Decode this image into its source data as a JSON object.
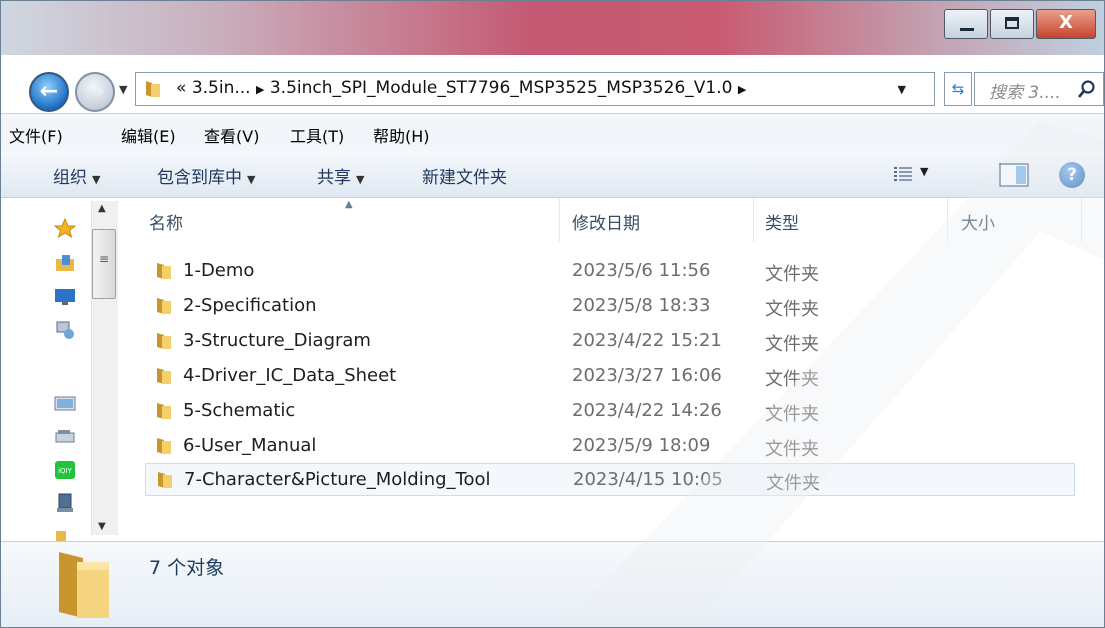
{
  "window": {
    "minimize_icon": "minimize-icon",
    "maximize_icon": "maximize-icon",
    "close_label": "X"
  },
  "address": {
    "overflow": "«",
    "crumb1": "3.5in...",
    "separator": "▶",
    "crumb2": "3.5inch_SPI_Module_ST7796_MSP3525_MSP3526_V1.0",
    "dropdown": "▼",
    "refresh": "⇆"
  },
  "search": {
    "placeholder": "搜索 3...."
  },
  "menu": {
    "file": "文件(F)",
    "edit": "编辑(E)",
    "view": "查看(V)",
    "tools": "工具(T)",
    "help": "帮助(H)"
  },
  "toolbar": {
    "organize": "组织",
    "include": "包含到库中",
    "share": "共享",
    "new_folder": "新建文件夹",
    "caret": "▼",
    "help": "?"
  },
  "columns": {
    "name": "名称",
    "date": "修改日期",
    "type": "类型",
    "size": "大小"
  },
  "files": [
    {
      "name": "1-Demo",
      "date": "2023/5/6 11:56",
      "type": "文件夹"
    },
    {
      "name": "2-Specification",
      "date": "2023/5/8 18:33",
      "type": "文件夹"
    },
    {
      "name": "3-Structure_Diagram",
      "date": "2023/4/22 15:21",
      "type": "文件夹"
    },
    {
      "name": "4-Driver_IC_Data_Sheet",
      "date": "2023/3/27 16:06",
      "type": "文件夹"
    },
    {
      "name": "5-Schematic",
      "date": "2023/4/22 14:26",
      "type": "文件夹"
    },
    {
      "name": "6-User_Manual",
      "date": "2023/5/9 18:09",
      "type": "文件夹"
    },
    {
      "name": "7-Character&Picture_Molding_Tool",
      "date": "2023/4/15 10:05",
      "type": "文件夹"
    }
  ],
  "status": {
    "count": "7 个对象"
  },
  "colors": {
    "folder": "#e8b84a",
    "accent": "#1d6fc4"
  }
}
